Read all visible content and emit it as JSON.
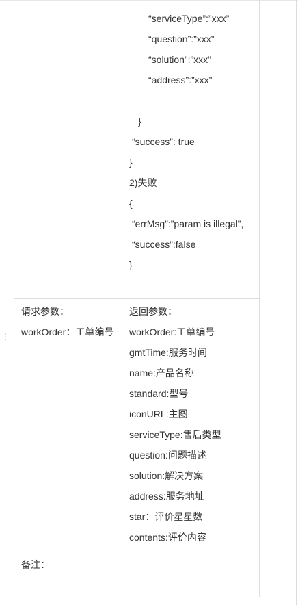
{
  "response_example": {
    "fields": [
      "“serviceType”:”xxx”",
      "“question”:”xxx”",
      "“solution”:”xxx”",
      "“address”:”xxx”"
    ],
    "inner_close": "}",
    "success_line": "“success”: true",
    "outer_close": "}",
    "failure_heading": "2)失败",
    "failure_open": "{",
    "err_line": "“errMsg”:”param is illegal”,",
    "failure_success_line": "“success”:false",
    "failure_close": "}"
  },
  "request_params": {
    "title": "请求参数：",
    "items": [
      "workOrder：工单编号"
    ]
  },
  "return_params": {
    "title": "返回参数：",
    "items": [
      "workOrder:工单编号",
      "gmtTime:服务时间",
      "name:产品名称",
      "standard:型号",
      "iconURL:主图",
      "serviceType:售后类型",
      "question:问题描述",
      "solution:解决方案",
      "address:服务地址",
      "star：评价星星数",
      "contents:评价内容"
    ]
  },
  "remarks": {
    "label": "备注："
  },
  "icons": {
    "drag_handle": "vertical-dots-icon"
  }
}
